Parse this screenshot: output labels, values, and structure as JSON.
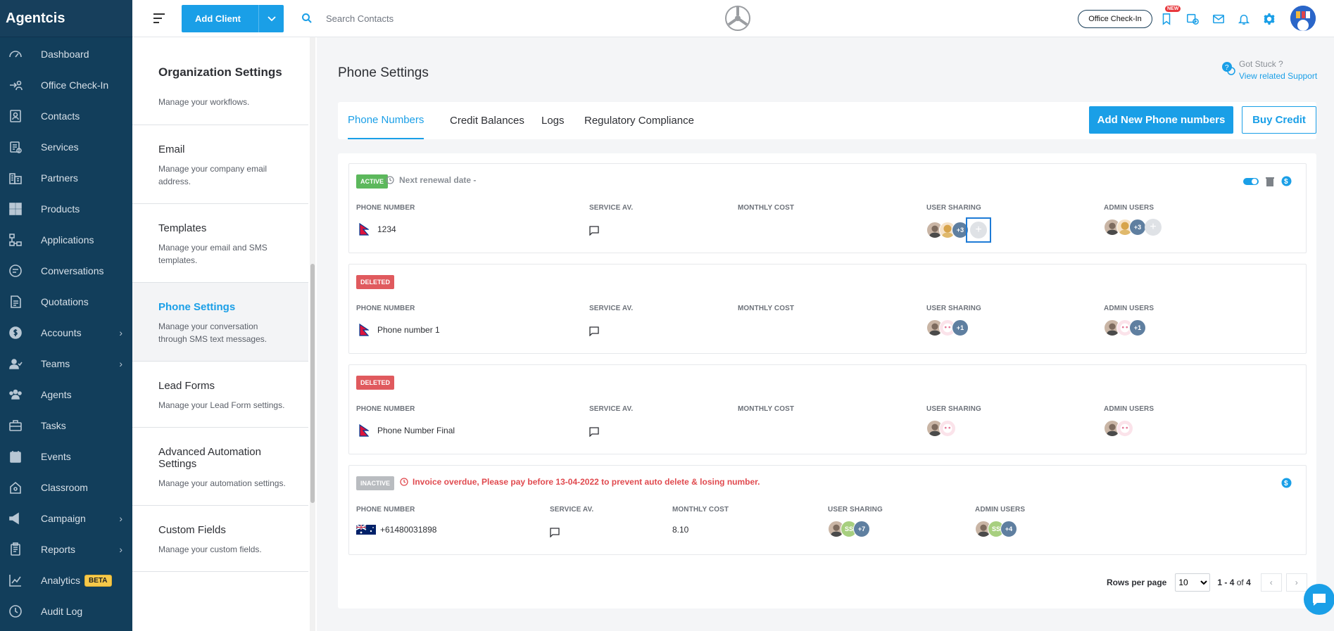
{
  "app": {
    "brand": "Agentcis"
  },
  "sidebar": {
    "items": [
      {
        "label": "Dashboard",
        "icon": "dashboard-icon",
        "has_children": false
      },
      {
        "label": "Office Check-In",
        "icon": "checkin-icon",
        "has_children": false
      },
      {
        "label": "Contacts",
        "icon": "contacts-icon",
        "has_children": false
      },
      {
        "label": "Services",
        "icon": "services-icon",
        "has_children": false
      },
      {
        "label": "Partners",
        "icon": "partners-icon",
        "has_children": false
      },
      {
        "label": "Products",
        "icon": "products-icon",
        "has_children": false
      },
      {
        "label": "Applications",
        "icon": "applications-icon",
        "has_children": false
      },
      {
        "label": "Conversations",
        "icon": "conversations-icon",
        "has_children": false
      },
      {
        "label": "Quotations",
        "icon": "quotations-icon",
        "has_children": false
      },
      {
        "label": "Accounts",
        "icon": "accounts-icon",
        "has_children": true
      },
      {
        "label": "Teams",
        "icon": "teams-icon",
        "has_children": true
      },
      {
        "label": "Agents",
        "icon": "agents-icon",
        "has_children": false
      },
      {
        "label": "Tasks",
        "icon": "tasks-icon",
        "has_children": false
      },
      {
        "label": "Events",
        "icon": "events-icon",
        "has_children": false
      },
      {
        "label": "Classroom",
        "icon": "classroom-icon",
        "has_children": false
      },
      {
        "label": "Campaign",
        "icon": "campaign-icon",
        "has_children": true
      },
      {
        "label": "Reports",
        "icon": "reports-icon",
        "has_children": true
      },
      {
        "label": "Analytics",
        "icon": "analytics-icon",
        "has_children": false,
        "badge": "BETA"
      },
      {
        "label": "Audit Log",
        "icon": "audit-log-icon",
        "has_children": false
      }
    ]
  },
  "topbar": {
    "add_client_label": "Add Client",
    "search_placeholder": "Search Contacts",
    "checkin_label": "Office Check-In",
    "new_badge": "NEW"
  },
  "settings": {
    "title": "Organization Settings",
    "clipped_description": "Manage your workflows.",
    "items": [
      {
        "title": "Email",
        "description": "Manage your company email address.",
        "active": false
      },
      {
        "title": "Templates",
        "description": "Manage your email and SMS templates.",
        "active": false
      },
      {
        "title": "Phone Settings",
        "description": "Manage your conversation through SMS text messages.",
        "active": true
      },
      {
        "title": "Lead Forms",
        "description": "Manage your Lead Form settings.",
        "active": false
      },
      {
        "title": "Advanced Automation Settings",
        "description": "Manage your automation settings.",
        "active": false
      },
      {
        "title": "Custom Fields",
        "description": "Manage your custom fields.",
        "active": false
      }
    ]
  },
  "main": {
    "page_title": "Phone Settings",
    "support_question": "Got Stuck ?",
    "support_link": "View related Support",
    "tabs": [
      {
        "label": "Phone Numbers",
        "active": true
      },
      {
        "label": "Credit Balances",
        "active": false
      },
      {
        "label": "Logs",
        "active": false
      },
      {
        "label": "Regulatory Compliance",
        "active": false
      }
    ],
    "add_phone_label": "Add New Phone numbers",
    "buy_credit_label": "Buy Credit",
    "columns": {
      "phone_number": "PHONE NUMBER",
      "service": "SERVICE AV.",
      "monthly_cost": "MONTHLY COST",
      "user_sharing": "USER SHARING",
      "admin_users": "ADMIN USERS"
    },
    "rows": [
      {
        "status": "ACTIVE",
        "note": "Next renewal date -",
        "number": "1234",
        "country": "nepal",
        "monthly_cost": "",
        "user_more": "+3",
        "admin_more": "+3"
      },
      {
        "status": "DELETED",
        "number": "Phone number 1",
        "country": "nepal",
        "monthly_cost": "",
        "user_more": "+1",
        "admin_more": "+1"
      },
      {
        "status": "DELETED",
        "number": "Phone Number Final",
        "country": "nepal",
        "monthly_cost": "",
        "user_more": "",
        "admin_more": ""
      },
      {
        "status": "INACTIVE",
        "note": "Invoice overdue, Please pay before 13-04-2022 to prevent auto delete & losing number.",
        "number": "+61480031898",
        "country": "australia",
        "monthly_cost": "8.10",
        "user_initials": "SS",
        "user_more": "+7",
        "admin_initials": "SS",
        "admin_more": "+4"
      }
    ],
    "pager": {
      "rows_per_page_label": "Rows per page",
      "rows_per_page_value": "10",
      "range": "1 - 4",
      "of_label": "of",
      "total": "4"
    }
  },
  "colors": {
    "sidebar_bg": "#123e5b",
    "primary": "#1a9fe7",
    "active_status": "#5cb85c",
    "deleted_status": "#e05a5e",
    "inactive_status": "#b9bcc0",
    "overdue_text": "#e04a4f"
  }
}
